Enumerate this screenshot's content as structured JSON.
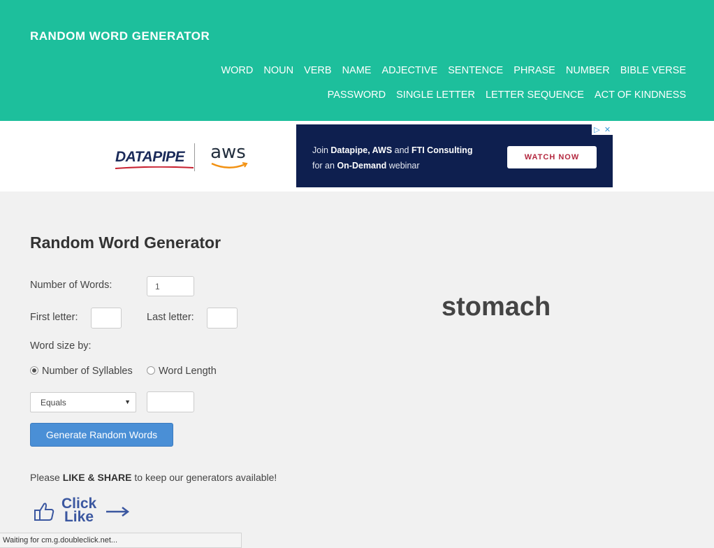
{
  "header": {
    "brand": "RANDOM WORD GENERATOR",
    "nav_row1": [
      "WORD",
      "NOUN",
      "VERB",
      "NAME",
      "ADJECTIVE",
      "SENTENCE",
      "PHRASE",
      "NUMBER",
      "BIBLE VERSE"
    ],
    "nav_row2": [
      "PASSWORD",
      "SINGLE LETTER",
      "LETTER SEQUENCE",
      "ACT OF KINDNESS"
    ]
  },
  "ad": {
    "logo_datapipe": "DATAPIPE",
    "logo_aws": "aws",
    "line1_pre": "Join ",
    "line1_b1": "Datapipe, AWS",
    "line1_mid": " and ",
    "line1_b2": "FTI Consulting",
    "line2_pre": "for an ",
    "line2_b": "On-Demand",
    "line2_post": " webinar",
    "cta": "WATCH NOW",
    "choices_icon": "▷",
    "close_icon": "✕"
  },
  "form": {
    "title": "Random Word Generator",
    "num_words_label": "Number of Words:",
    "num_words_value": "1",
    "first_letter_label": "First letter:",
    "first_letter_value": "",
    "last_letter_label": "Last letter:",
    "last_letter_value": "",
    "word_size_label": "Word size by:",
    "radio_syllables": "Number of Syllables",
    "radio_length": "Word Length",
    "selected_radio": "syllables",
    "compare_select": "Equals",
    "size_value": "",
    "generate_button": "Generate Random Words"
  },
  "result": {
    "word": "stomach"
  },
  "share": {
    "pre": "Please ",
    "like": "LIKE",
    "amp": " & ",
    "share": "SHARE",
    "post": " to keep our generators available!",
    "like_click": "Click",
    "like_like": "Like"
  },
  "status": {
    "text": "Waiting for cm.g.doubleclick.net..."
  },
  "colors": {
    "header_bg": "#1dbf9c",
    "ad_bg": "#0e1f4f",
    "button_bg": "#4a8fd6",
    "like_blue": "#3b57a0",
    "cta_red": "#b4283f"
  }
}
